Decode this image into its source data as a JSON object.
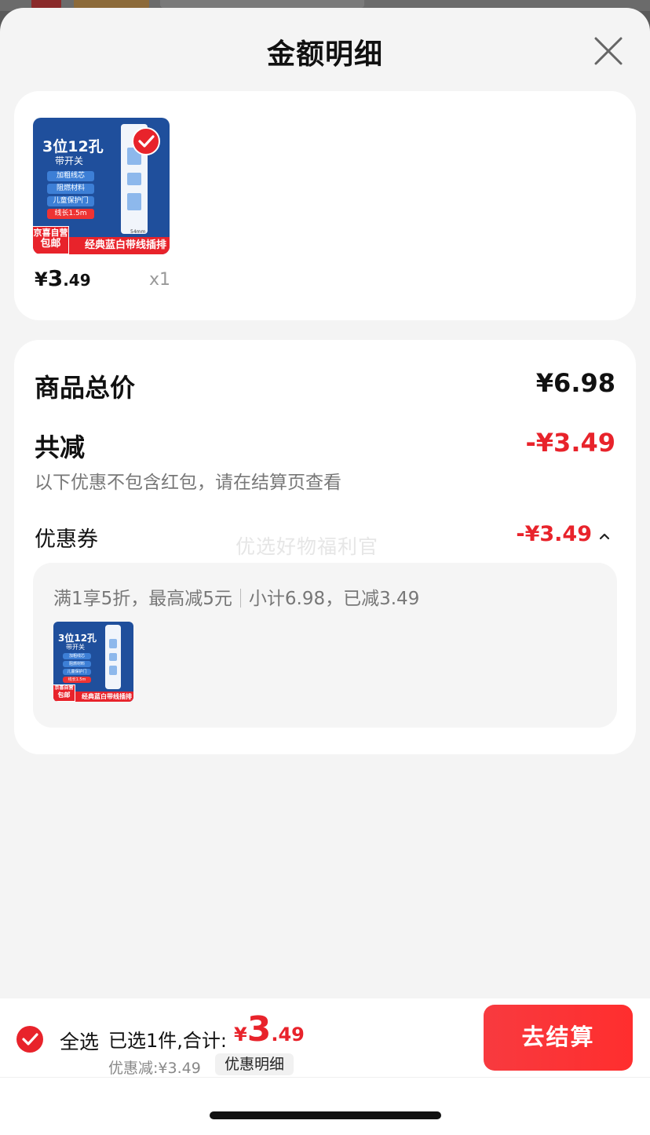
{
  "sheet": {
    "title": "金额明细"
  },
  "product": {
    "thumbnail": {
      "headline": "3位12孔",
      "subline": "带开关",
      "features": [
        "加粗线芯",
        "阻燃材料",
        "儿童保护门",
        "线长1.5m"
      ],
      "badge_top": "京喜自营",
      "badge_bottom": "包邮",
      "banner": "经典蓝白带线插排",
      "size_label": "54mm"
    },
    "price_currency": "¥",
    "price_int": "3",
    "price_dec": ".49",
    "quantity": "x1"
  },
  "summary": {
    "total_label": "商品总价",
    "total_value": "¥6.98",
    "reduce_label": "共减",
    "reduce_value": "-¥3.49",
    "note": "以下优惠不包含红包，请在结算页查看",
    "coupon_label": "优惠券",
    "coupon_value": "-¥3.49",
    "watermark": "优选好物福利官",
    "coupon_rule": "满1享5折，最高减5元",
    "coupon_subtotal": "小计6.98，已减3.49"
  },
  "bottom_bar": {
    "select_all": "全选",
    "selected_info": "已选1件,合计:",
    "total_currency": "¥",
    "total_int": "3",
    "total_dec": ".49",
    "discount": "优惠减:¥3.49",
    "detail_chip": "优惠明细",
    "checkout": "去结算"
  },
  "colors": {
    "accent_red": "#e8232b",
    "product_blue": "#1f4f9c"
  }
}
